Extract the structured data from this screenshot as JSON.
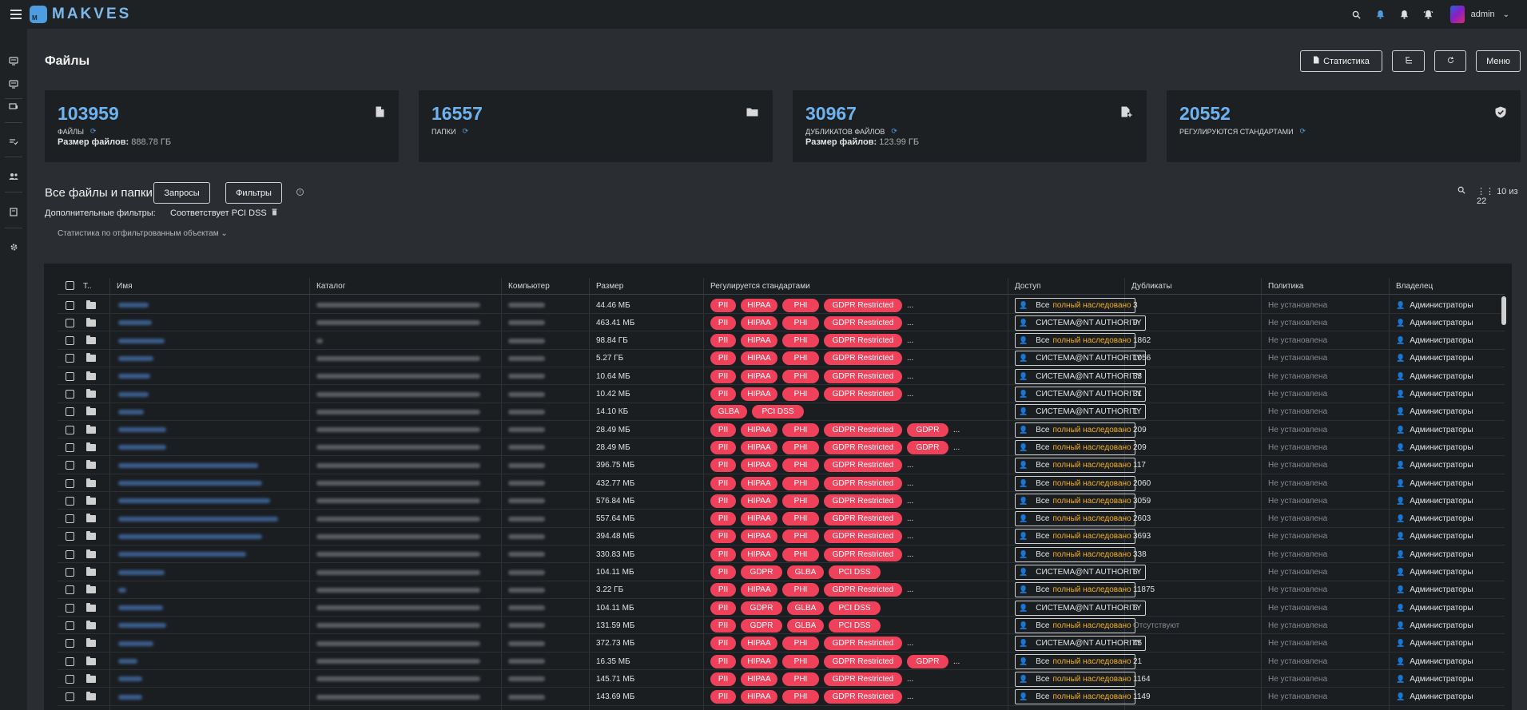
{
  "topbar": {
    "logo_mark": "M",
    "logo_text": "MAKVES",
    "user": "admin"
  },
  "header": {
    "title": "Файлы",
    "btn_stats": "Статистика",
    "btn_menu": "Меню"
  },
  "cards": [
    {
      "value": "103959",
      "label": "Файлы",
      "size_label": "Размер файлов:",
      "size_value": "888.78 ГБ",
      "icon": "file-icon"
    },
    {
      "value": "16557",
      "label": "Папки",
      "size_label": "",
      "size_value": "",
      "icon": "folder-icon"
    },
    {
      "value": "30967",
      "label": "Дубликатов файлов",
      "size_label": "Размер файлов:",
      "size_value": "123.99 ГБ",
      "icon": "file-duplicate-icon"
    },
    {
      "value": "20552",
      "label": "Регулируются стандартами",
      "size_label": "",
      "size_value": "",
      "icon": "shield-check-icon"
    }
  ],
  "section": {
    "title": "Все файлы и папки",
    "btn_queries": "Запросы",
    "btn_filters": "Фильтры",
    "extra_filters_label": "Дополнительные фильтры:",
    "extra_filters_value": "Соответствует PCI DSS",
    "stats_filtered": "Статистика по отфильтрованным объектам",
    "pagination": "10 из 22"
  },
  "table": {
    "headers": [
      "Т..",
      "Имя",
      "Каталог",
      "Компьютер",
      "Размер",
      "Регулируется стандартами",
      "Доступ",
      "Дубликаты",
      "Политика",
      "Владелец"
    ],
    "access_all": "Все",
    "access_inherited": "полный наследовано",
    "access_system": "СИСТЕМА@NT AUTHORITY",
    "rows": [
      {
        "size": "44.46 МБ",
        "tags": [
          "PII",
          "HIPAA",
          "PHI",
          "GDPR Restricted"
        ],
        "more": "...",
        "access": "all",
        "dup": "3",
        "policy": "Не установлена",
        "owner": "Администраторы"
      },
      {
        "size": "463.41 МБ",
        "tags": [
          "PII",
          "HIPAA",
          "PHI",
          "GDPR Restricted"
        ],
        "more": "...",
        "access": "system",
        "dup": "9",
        "policy": "Не установлена",
        "owner": "Администраторы"
      },
      {
        "size": "98.84 ГБ",
        "tags": [
          "PII",
          "HIPAA",
          "PHI",
          "GDPR Restricted"
        ],
        "more": "...",
        "access": "all",
        "dup": "1862",
        "policy": "Не установлена",
        "owner": "Администраторы"
      },
      {
        "size": "5.27 ГБ",
        "tags": [
          "PII",
          "HIPAA",
          "PHI",
          "GDPR Restricted"
        ],
        "more": "...",
        "access": "system",
        "dup": "1056",
        "policy": "Не установлена",
        "owner": "Администраторы"
      },
      {
        "size": "10.64 МБ",
        "tags": [
          "PII",
          "HIPAA",
          "PHI",
          "GDPR Restricted"
        ],
        "more": "...",
        "access": "system",
        "dup": "33",
        "policy": "Не установлена",
        "owner": "Администраторы"
      },
      {
        "size": "10.42 МБ",
        "tags": [
          "PII",
          "HIPAA",
          "PHI",
          "GDPR Restricted"
        ],
        "more": "...",
        "access": "system",
        "dup": "31",
        "policy": "Не установлена",
        "owner": "Администраторы"
      },
      {
        "size": "14.10 КБ",
        "tags": [
          "GLBA",
          "PCI DSS"
        ],
        "more": "",
        "access": "system",
        "dup": "1",
        "policy": "Не установлена",
        "owner": "Администраторы"
      },
      {
        "size": "28.49 МБ",
        "tags": [
          "PII",
          "HIPAA",
          "PHI",
          "GDPR Restricted",
          "GDPR"
        ],
        "more": "...",
        "access": "all",
        "dup": "209",
        "policy": "Не установлена",
        "owner": "Администраторы"
      },
      {
        "size": "28.49 МБ",
        "tags": [
          "PII",
          "HIPAA",
          "PHI",
          "GDPR Restricted",
          "GDPR"
        ],
        "more": "...",
        "access": "all",
        "dup": "209",
        "policy": "Не установлена",
        "owner": "Администраторы"
      },
      {
        "size": "396.75 МБ",
        "tags": [
          "PII",
          "HIPAA",
          "PHI",
          "GDPR Restricted"
        ],
        "more": "...",
        "access": "all",
        "dup": "117",
        "policy": "Не установлена",
        "owner": "Администраторы"
      },
      {
        "size": "432.77 МБ",
        "tags": [
          "PII",
          "HIPAA",
          "PHI",
          "GDPR Restricted"
        ],
        "more": "...",
        "access": "all",
        "dup": "2060",
        "policy": "Не установлена",
        "owner": "Администраторы"
      },
      {
        "size": "576.84 МБ",
        "tags": [
          "PII",
          "HIPAA",
          "PHI",
          "GDPR Restricted"
        ],
        "more": "...",
        "access": "all",
        "dup": "3059",
        "policy": "Не установлена",
        "owner": "Администраторы"
      },
      {
        "size": "557.64 МБ",
        "tags": [
          "PII",
          "HIPAA",
          "PHI",
          "GDPR Restricted"
        ],
        "more": "...",
        "access": "all",
        "dup": "2603",
        "policy": "Не установлена",
        "owner": "Администраторы"
      },
      {
        "size": "394.48 МБ",
        "tags": [
          "PII",
          "HIPAA",
          "PHI",
          "GDPR Restricted"
        ],
        "more": "...",
        "access": "all",
        "dup": "3693",
        "policy": "Не установлена",
        "owner": "Администраторы"
      },
      {
        "size": "330.83 МБ",
        "tags": [
          "PII",
          "HIPAA",
          "PHI",
          "GDPR Restricted"
        ],
        "more": "...",
        "access": "all",
        "dup": "338",
        "policy": "Не установлена",
        "owner": "Администраторы"
      },
      {
        "size": "104.11 МБ",
        "tags": [
          "PII",
          "GDPR",
          "GLBA",
          "PCI DSS"
        ],
        "more": "",
        "access": "system",
        "dup": "6",
        "policy": "Не установлена",
        "owner": "Администраторы"
      },
      {
        "size": "3.22 ГБ",
        "tags": [
          "PII",
          "HIPAA",
          "PHI",
          "GDPR Restricted"
        ],
        "more": "...",
        "access": "all",
        "dup": "11875",
        "policy": "Не установлена",
        "owner": "Администраторы"
      },
      {
        "size": "104.11 МБ",
        "tags": [
          "PII",
          "GDPR",
          "GLBA",
          "PCI DSS"
        ],
        "more": "",
        "access": "system",
        "dup": "6",
        "policy": "Не установлена",
        "owner": "Администраторы"
      },
      {
        "size": "131.59 МБ",
        "tags": [
          "PII",
          "GDPR",
          "GLBA",
          "PCI DSS"
        ],
        "more": "",
        "access": "all",
        "dup": "Отсутствуют",
        "policy": "Не установлена",
        "owner": "Администраторы"
      },
      {
        "size": "372.73 МБ",
        "tags": [
          "PII",
          "HIPAA",
          "PHI",
          "GDPR Restricted"
        ],
        "more": "...",
        "access": "system",
        "dup": "45",
        "policy": "Не установлена",
        "owner": "Администраторы"
      },
      {
        "size": "16.35 МБ",
        "tags": [
          "PII",
          "HIPAA",
          "PHI",
          "GDPR Restricted",
          "GDPR"
        ],
        "more": "...",
        "access": "all",
        "dup": "21",
        "policy": "Не установлена",
        "owner": "Администраторы"
      },
      {
        "size": "145.71 МБ",
        "tags": [
          "PII",
          "HIPAA",
          "PHI",
          "GDPR Restricted"
        ],
        "more": "...",
        "access": "all",
        "dup": "1164",
        "policy": "Не установлена",
        "owner": "Администраторы"
      },
      {
        "size": "143.69 МБ",
        "tags": [
          "PII",
          "HIPAA",
          "PHI",
          "GDPR Restricted"
        ],
        "more": "...",
        "access": "all",
        "dup": "1149",
        "policy": "Не установлена",
        "owner": "Администраторы"
      }
    ]
  }
}
